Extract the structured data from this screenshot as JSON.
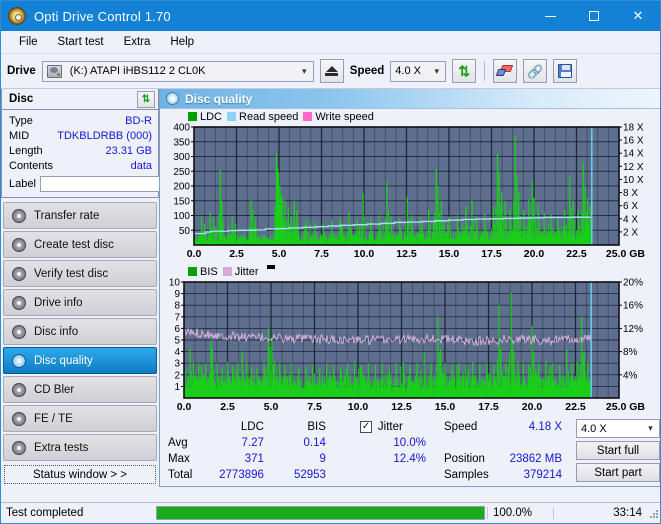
{
  "window": {
    "title": "Opti Drive Control 1.70",
    "icon": "disc-icon",
    "minimize": "–",
    "maximize": "□",
    "close": "✕"
  },
  "menu": [
    {
      "label": "File"
    },
    {
      "label": "Start test"
    },
    {
      "label": "Extra"
    },
    {
      "label": "Help"
    }
  ],
  "toolbar": {
    "drive_label": "Drive",
    "drive_value": "(K:)  ATAPI iHBS112  2 CL0K",
    "eject_title": "Eject",
    "speed_label": "Speed",
    "speed_value": "4.0 X",
    "refresh_icon": "refresh-icon",
    "erase_icon": "erase-icon",
    "chain_icon": "chain-icon",
    "save_icon": "save-icon"
  },
  "disc": {
    "header": "Disc",
    "refresh_icon": "refresh-icon",
    "rows": [
      {
        "key": "Type",
        "value": "BD-R"
      },
      {
        "key": "MID",
        "value": "TDKBLDRBB (000)"
      },
      {
        "key": "Length",
        "value": "23.31 GB"
      },
      {
        "key": "Contents",
        "value": "data"
      }
    ],
    "label_key": "Label",
    "label_value": "",
    "label_placeholder": "",
    "disc_icon": "cd-disc-icon"
  },
  "nav": {
    "items": [
      {
        "label": "Transfer rate",
        "active": false
      },
      {
        "label": "Create test disc",
        "active": false
      },
      {
        "label": "Verify test disc",
        "active": false
      },
      {
        "label": "Drive info",
        "active": false
      },
      {
        "label": "Disc info",
        "active": false
      },
      {
        "label": "Disc quality",
        "active": true
      },
      {
        "label": "CD Bler",
        "active": false
      },
      {
        "label": "FE / TE",
        "active": false
      },
      {
        "label": "Extra tests",
        "active": false
      }
    ],
    "status_window": "Status window > >"
  },
  "main": {
    "title": "Disc quality",
    "icon": "disc-quality-icon"
  },
  "chart_data": [
    {
      "type": "area",
      "id": "ldc-chart",
      "title": "",
      "xlabel": "GB",
      "ylabel": "",
      "xlim": [
        0,
        25
      ],
      "ylim": [
        0,
        400
      ],
      "y2lim": [
        0,
        18
      ],
      "xticks": [
        "0.0",
        "2.5",
        "5.0",
        "7.5",
        "10.0",
        "12.5",
        "15.0",
        "17.5",
        "20.0",
        "22.5",
        "25.0 GB"
      ],
      "yticks": [
        50,
        100,
        150,
        200,
        250,
        300,
        350,
        400
      ],
      "y2ticks": [
        "2 X",
        "4 X",
        "6 X",
        "8 X",
        "10 X",
        "12 X",
        "14 X",
        "16 X",
        "18 X"
      ],
      "grid": true,
      "legend_position": "top-left",
      "legend": [
        {
          "name": "LDC",
          "color": "#00a000"
        },
        {
          "name": "Read speed",
          "color": "#8ad4f5"
        },
        {
          "name": "Write speed",
          "color": "#ff66cc"
        }
      ],
      "plot_bg": "#5d6e8e",
      "grid_color": "#1d2433",
      "data_end_gb": 23.4,
      "series": [
        {
          "name": "LDC",
          "type": "impulse",
          "color": "#19d019",
          "baseline_profile": [
            28,
            30,
            32,
            30,
            33,
            31,
            34,
            33,
            36,
            35,
            38,
            36,
            40,
            38,
            42,
            40,
            44,
            42,
            46,
            45
          ],
          "spikes": [
            [
              0.45,
              95
            ],
            [
              0.62,
              72
            ],
            [
              0.95,
              110
            ],
            [
              1.15,
              92
            ],
            [
              1.55,
              255
            ],
            [
              1.62,
              150
            ],
            [
              2.25,
              96
            ],
            [
              2.45,
              72
            ],
            [
              3.35,
              152
            ],
            [
              3.45,
              120
            ],
            [
              3.62,
              90
            ],
            [
              4.85,
              312
            ],
            [
              4.92,
              262
            ],
            [
              4.98,
              245
            ],
            [
              5.05,
              200
            ],
            [
              5.12,
              175
            ],
            [
              5.2,
              160
            ],
            [
              5.35,
              150
            ],
            [
              5.55,
              128
            ],
            [
              5.7,
              96
            ],
            [
              5.9,
              150
            ],
            [
              6.05,
              118
            ],
            [
              6.6,
              85
            ],
            [
              7.1,
              80
            ],
            [
              7.6,
              76
            ],
            [
              8.1,
              84
            ],
            [
              8.6,
              92
            ],
            [
              9.1,
              110
            ],
            [
              9.6,
              86
            ],
            [
              9.95,
              175
            ],
            [
              10.4,
              92
            ],
            [
              10.9,
              100
            ],
            [
              11.35,
              215
            ],
            [
              11.6,
              96
            ],
            [
              12.1,
              90
            ],
            [
              12.55,
              165
            ],
            [
              12.8,
              100
            ],
            [
              13.3,
              95
            ],
            [
              13.8,
              120
            ],
            [
              14.25,
              258
            ],
            [
              14.35,
              200
            ],
            [
              14.55,
              150
            ],
            [
              15.0,
              96
            ],
            [
              15.5,
              100
            ],
            [
              16.0,
              130
            ],
            [
              16.35,
              155
            ],
            [
              16.6,
              96
            ],
            [
              17.1,
              104
            ],
            [
              17.6,
              130
            ],
            [
              17.85,
              310
            ],
            [
              17.95,
              250
            ],
            [
              18.1,
              180
            ],
            [
              18.3,
              150
            ],
            [
              18.6,
              120
            ],
            [
              18.9,
              370
            ],
            [
              19.0,
              240
            ],
            [
              19.1,
              178
            ],
            [
              19.4,
              120
            ],
            [
              19.7,
              155
            ],
            [
              19.9,
              218
            ],
            [
              20.0,
              160
            ],
            [
              20.25,
              140
            ],
            [
              20.6,
              110
            ],
            [
              21.0,
              104
            ],
            [
              21.4,
              96
            ],
            [
              21.8,
              120
            ],
            [
              22.1,
              230
            ],
            [
              22.3,
              150
            ],
            [
              22.6,
              120
            ],
            [
              22.9,
              280
            ],
            [
              23.0,
              200
            ],
            [
              23.15,
              160
            ],
            [
              23.3,
              130
            ]
          ]
        },
        {
          "name": "Read speed",
          "type": "step-line",
          "color": "#a8dff7",
          "points": [
            [
              0.0,
              1.7
            ],
            [
              0.7,
              1.75
            ],
            [
              1.0,
              2.0
            ],
            [
              2.0,
              2.1
            ],
            [
              2.6,
              2.2
            ],
            [
              3.6,
              2.25
            ],
            [
              4.2,
              2.3
            ],
            [
              4.9,
              2.45
            ],
            [
              5.6,
              2.5
            ],
            [
              6.4,
              2.6
            ],
            [
              7.2,
              2.7
            ],
            [
              7.9,
              2.8
            ],
            [
              8.6,
              2.9
            ],
            [
              9.4,
              3.0
            ],
            [
              10.2,
              3.1
            ],
            [
              11.0,
              3.2
            ],
            [
              11.8,
              3.3
            ],
            [
              12.6,
              3.45
            ],
            [
              13.4,
              3.5
            ],
            [
              14.2,
              3.6
            ],
            [
              15.0,
              3.7
            ],
            [
              15.8,
              3.8
            ],
            [
              16.6,
              3.9
            ],
            [
              17.4,
              3.95
            ],
            [
              18.2,
              4.0
            ],
            [
              19.0,
              4.05
            ],
            [
              19.8,
              4.1
            ],
            [
              20.6,
              4.15
            ],
            [
              21.4,
              4.2
            ],
            [
              22.2,
              4.2
            ],
            [
              23.0,
              4.25
            ],
            [
              23.35,
              4.25
            ]
          ]
        },
        {
          "name": "Write speed",
          "type": "none",
          "color": "#ff66cc",
          "points": []
        }
      ],
      "cursor_gb": 23.4,
      "cursor_color": "#6fd4f5"
    },
    {
      "type": "area",
      "id": "bis-jitter-chart",
      "title": "",
      "xlabel": "GB",
      "ylabel": "",
      "xlim": [
        0,
        25
      ],
      "ylim": [
        0,
        10
      ],
      "y2lim": [
        0,
        20
      ],
      "xticks": [
        "0.0",
        "2.5",
        "5.0",
        "7.5",
        "10.0",
        "12.5",
        "15.0",
        "17.5",
        "20.0",
        "22.5",
        "25.0 GB"
      ],
      "yticks": [
        1,
        2,
        3,
        4,
        5,
        6,
        7,
        8,
        9,
        10
      ],
      "y2ticks": [
        "4%",
        "8%",
        "12%",
        "16%",
        "20%"
      ],
      "grid": true,
      "legend_position": "top-left",
      "legend": [
        {
          "name": "BIS",
          "color": "#00a000"
        },
        {
          "name": "Jitter",
          "color": "#d8a8d8"
        },
        {
          "name": "marker",
          "color": "#000000"
        }
      ],
      "plot_bg": "#5d6e8e",
      "grid_color": "#1d2433",
      "data_end_gb": 23.4,
      "series": [
        {
          "name": "BIS",
          "type": "impulse",
          "color": "#19d019",
          "base_band": 2.0,
          "spikes": [
            [
              0.35,
              4.2
            ],
            [
              0.55,
              3.1
            ],
            [
              0.85,
              3.0
            ],
            [
              1.0,
              2.8
            ],
            [
              1.25,
              3.0
            ],
            [
              1.55,
              5.0
            ],
            [
              1.62,
              4.3
            ],
            [
              1.9,
              3.0
            ],
            [
              2.2,
              2.6
            ],
            [
              2.5,
              3.1
            ],
            [
              2.8,
              2.8
            ],
            [
              3.1,
              3.0
            ],
            [
              3.35,
              4.0
            ],
            [
              3.6,
              3.1
            ],
            [
              3.9,
              2.7
            ],
            [
              4.2,
              2.6
            ],
            [
              4.6,
              3.0
            ],
            [
              4.85,
              6.0
            ],
            [
              4.95,
              4.4
            ],
            [
              5.05,
              5.2
            ],
            [
              5.2,
              3.2
            ],
            [
              5.5,
              3.0
            ],
            [
              5.8,
              2.8
            ],
            [
              6.2,
              3.0
            ],
            [
              6.6,
              2.7
            ],
            [
              7.0,
              2.7
            ],
            [
              7.4,
              2.9
            ],
            [
              7.8,
              2.6
            ],
            [
              8.2,
              3.0
            ],
            [
              8.6,
              2.8
            ],
            [
              9.0,
              2.7
            ],
            [
              9.4,
              3.0
            ],
            [
              9.8,
              3.1
            ],
            [
              10.2,
              2.8
            ],
            [
              10.6,
              3.0
            ],
            [
              11.0,
              2.9
            ],
            [
              11.4,
              3.0
            ],
            [
              11.8,
              2.8
            ],
            [
              12.2,
              3.0
            ],
            [
              12.6,
              3.1
            ],
            [
              13.0,
              2.8
            ],
            [
              13.4,
              3.0
            ],
            [
              13.8,
              4.0
            ],
            [
              14.2,
              3.0
            ],
            [
              14.6,
              7.0
            ],
            [
              14.75,
              4.2
            ],
            [
              15.0,
              3.0
            ],
            [
              15.4,
              2.9
            ],
            [
              15.8,
              3.0
            ],
            [
              16.2,
              2.8
            ],
            [
              16.6,
              3.1
            ],
            [
              17.0,
              2.9
            ],
            [
              17.4,
              3.0
            ],
            [
              17.8,
              2.9
            ],
            [
              18.1,
              8.0
            ],
            [
              18.2,
              4.2
            ],
            [
              18.5,
              3.0
            ],
            [
              18.8,
              9.1
            ],
            [
              18.95,
              4.0
            ],
            [
              19.2,
              3.2
            ],
            [
              19.5,
              3.0
            ],
            [
              19.8,
              2.9
            ],
            [
              20.0,
              6.2
            ],
            [
              20.1,
              4.0
            ],
            [
              20.4,
              3.0
            ],
            [
              20.8,
              3.2
            ],
            [
              21.2,
              3.0
            ],
            [
              21.6,
              2.9
            ],
            [
              22.0,
              4.2
            ],
            [
              22.3,
              3.0
            ],
            [
              22.6,
              3.1
            ],
            [
              22.85,
              7.0
            ],
            [
              23.0,
              4.0
            ],
            [
              23.2,
              3.1
            ]
          ]
        },
        {
          "name": "Jitter",
          "type": "noisy-line",
          "color": "#dcb4dc",
          "mean_profile": [
            5.7,
            5.6,
            5.4,
            5.3,
            5.2,
            5.2,
            5.1,
            5.1,
            5.05,
            5.0,
            5.0,
            5.0,
            5.05,
            5.1,
            5.15,
            5.05,
            4.95,
            4.9,
            5.05,
            5.1,
            5.0,
            5.0,
            5.05,
            5.1
          ],
          "amplitude": 0.4
        }
      ],
      "cursor_gb": 23.4,
      "cursor_color": "#6fd4f5"
    }
  ],
  "stats": {
    "row_labels": [
      "Avg",
      "Max",
      "Total"
    ],
    "columns": [
      {
        "header": "LDC",
        "values": [
          "7.27",
          "371",
          "2773896"
        ]
      },
      {
        "header": "BIS",
        "values": [
          "0.14",
          "9",
          "52953"
        ]
      }
    ],
    "jitter": {
      "label": "Jitter",
      "checked": true,
      "check_glyph": "✓",
      "avg": "10.0%",
      "max": "12.4%"
    },
    "speed": {
      "key": "Speed",
      "value": "4.18 X"
    },
    "position": {
      "key": "Position",
      "value": "23862 MB"
    },
    "samples": {
      "key": "Samples",
      "value": "379214"
    },
    "speed_select": "4.0 X",
    "start_full": "Start full",
    "start_part": "Start part"
  },
  "statusbar": {
    "message": "Test completed",
    "progress_percent": 100,
    "percent_text": "100.0%",
    "elapsed": "33:14"
  },
  "colors": {
    "accent": "#1281d6",
    "value_blue": "#1616d8",
    "plot_bg": "#5d6e8e",
    "green": "#19d019",
    "progress_green": "#19ab19"
  }
}
